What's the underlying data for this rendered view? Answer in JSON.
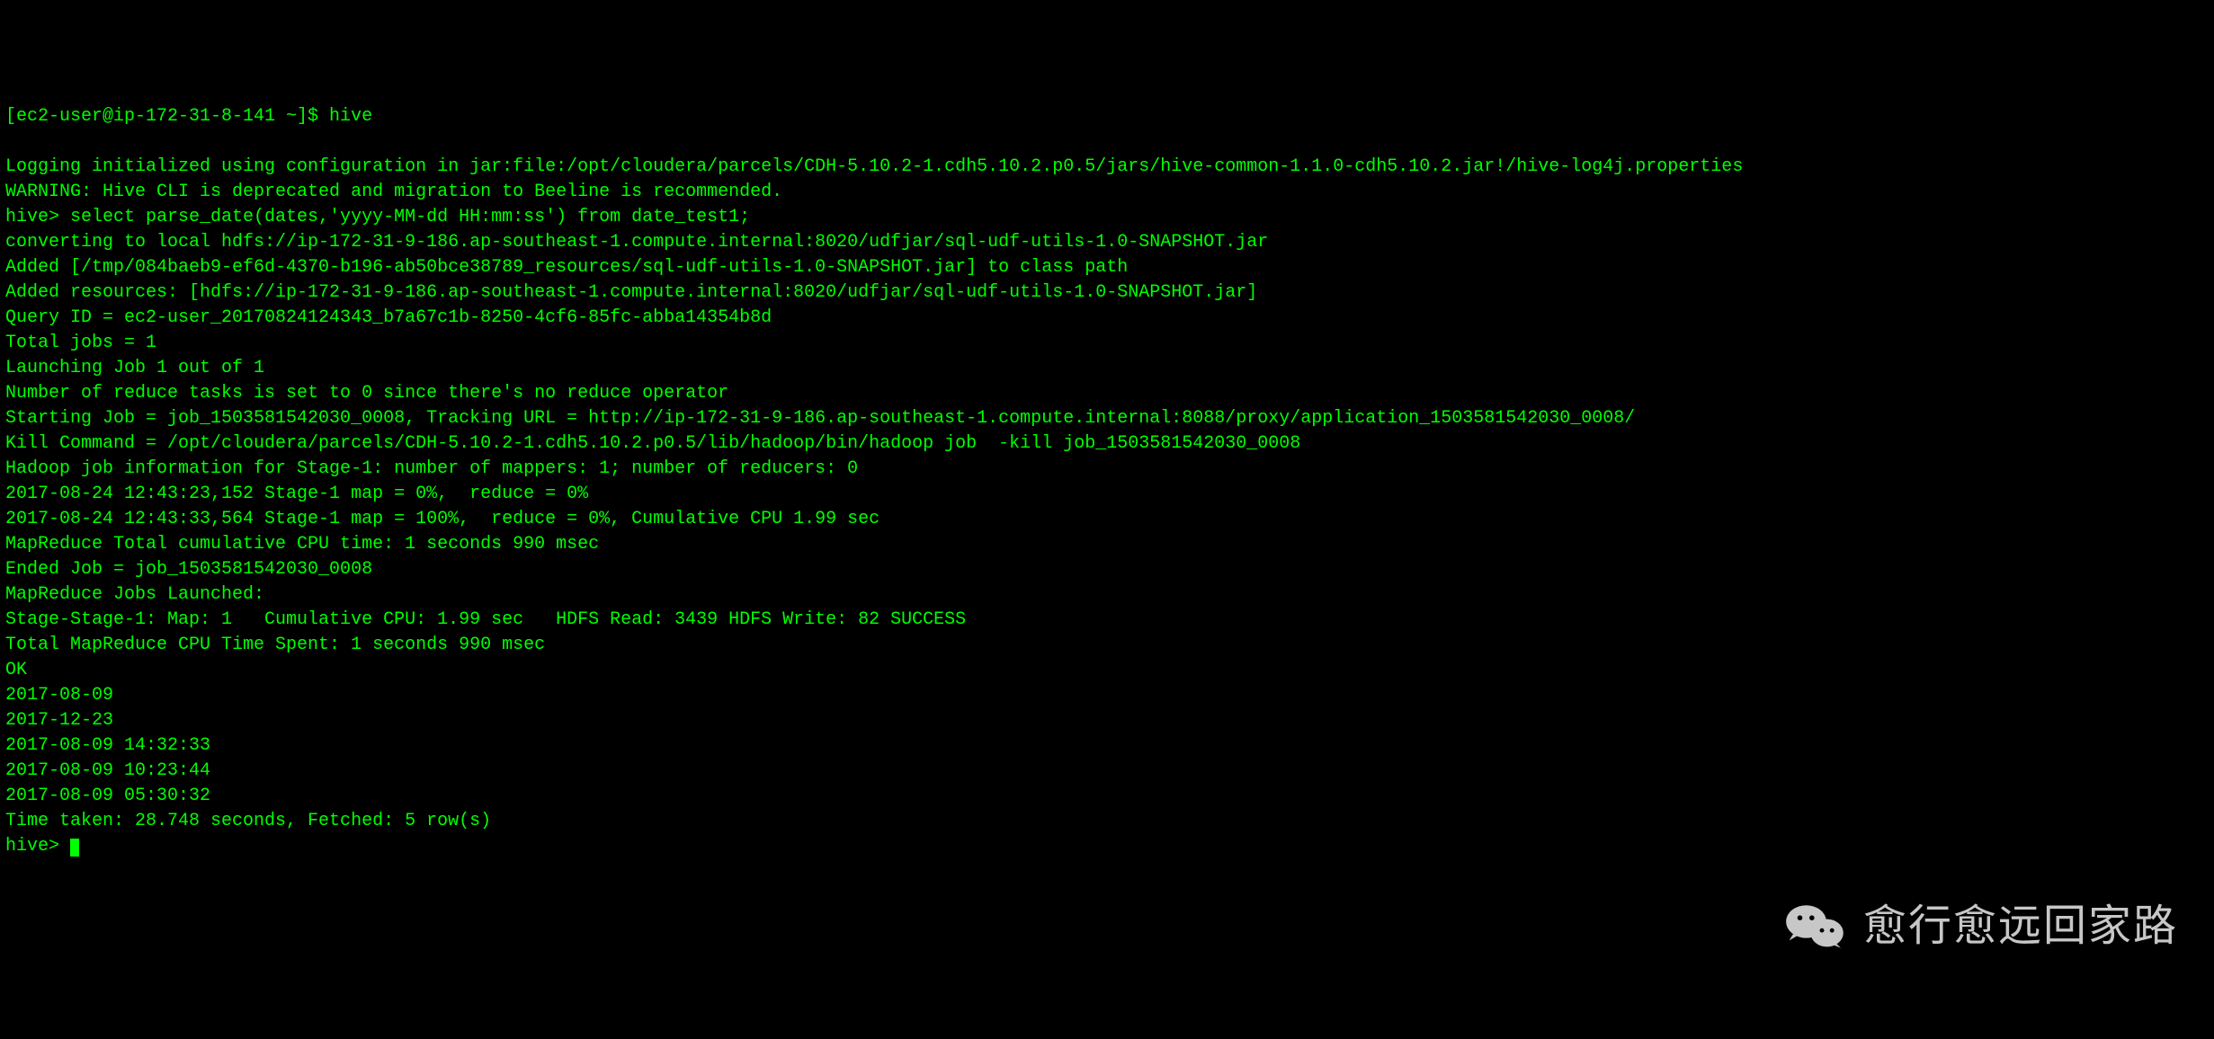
{
  "terminal": {
    "lines": [
      "[ec2-user@ip-172-31-8-141 ~]$ hive",
      "",
      "Logging initialized using configuration in jar:file:/opt/cloudera/parcels/CDH-5.10.2-1.cdh5.10.2.p0.5/jars/hive-common-1.1.0-cdh5.10.2.jar!/hive-log4j.properties",
      "WARNING: Hive CLI is deprecated and migration to Beeline is recommended.",
      "hive> select parse_date(dates,'yyyy-MM-dd HH:mm:ss') from date_test1;",
      "converting to local hdfs://ip-172-31-9-186.ap-southeast-1.compute.internal:8020/udfjar/sql-udf-utils-1.0-SNAPSHOT.jar",
      "Added [/tmp/084baeb9-ef6d-4370-b196-ab50bce38789_resources/sql-udf-utils-1.0-SNAPSHOT.jar] to class path",
      "Added resources: [hdfs://ip-172-31-9-186.ap-southeast-1.compute.internal:8020/udfjar/sql-udf-utils-1.0-SNAPSHOT.jar]",
      "Query ID = ec2-user_20170824124343_b7a67c1b-8250-4cf6-85fc-abba14354b8d",
      "Total jobs = 1",
      "Launching Job 1 out of 1",
      "Number of reduce tasks is set to 0 since there's no reduce operator",
      "Starting Job = job_1503581542030_0008, Tracking URL = http://ip-172-31-9-186.ap-southeast-1.compute.internal:8088/proxy/application_1503581542030_0008/",
      "Kill Command = /opt/cloudera/parcels/CDH-5.10.2-1.cdh5.10.2.p0.5/lib/hadoop/bin/hadoop job  -kill job_1503581542030_0008",
      "Hadoop job information for Stage-1: number of mappers: 1; number of reducers: 0",
      "2017-08-24 12:43:23,152 Stage-1 map = 0%,  reduce = 0%",
      "2017-08-24 12:43:33,564 Stage-1 map = 100%,  reduce = 0%, Cumulative CPU 1.99 sec",
      "MapReduce Total cumulative CPU time: 1 seconds 990 msec",
      "Ended Job = job_1503581542030_0008",
      "MapReduce Jobs Launched:",
      "Stage-Stage-1: Map: 1   Cumulative CPU: 1.99 sec   HDFS Read: 3439 HDFS Write: 82 SUCCESS",
      "Total MapReduce CPU Time Spent: 1 seconds 990 msec",
      "OK",
      "2017-08-09",
      "2017-12-23",
      "2017-08-09 14:32:33",
      "2017-08-09 10:23:44",
      "2017-08-09 05:30:32",
      "Time taken: 28.748 seconds, Fetched: 5 row(s)"
    ],
    "prompt": "hive> "
  },
  "watermark": {
    "text": "愈行愈远回家路"
  }
}
